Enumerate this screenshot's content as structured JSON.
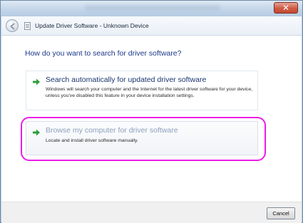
{
  "window": {
    "title": "Update Driver Software - Unknown Device",
    "close_glyph": "✕"
  },
  "main": {
    "heading": "How do you want to search for driver software?",
    "options": [
      {
        "title": "Search automatically for updated driver software",
        "description": "Windows will search your computer and the Internet for the latest driver software for your device, unless you've disabled this feature in your device installation settings.",
        "icon": "green-arrow-icon"
      },
      {
        "title": "Browse my computer for driver software",
        "description": "Locate and install driver software manually.",
        "icon": "green-arrow-icon",
        "highlighted": true
      }
    ]
  },
  "footer": {
    "cancel_label": "Cancel"
  },
  "colors": {
    "highlight": "#ec1ce8",
    "heading": "#1d3a8a",
    "arrow": "#2f9e3f"
  }
}
